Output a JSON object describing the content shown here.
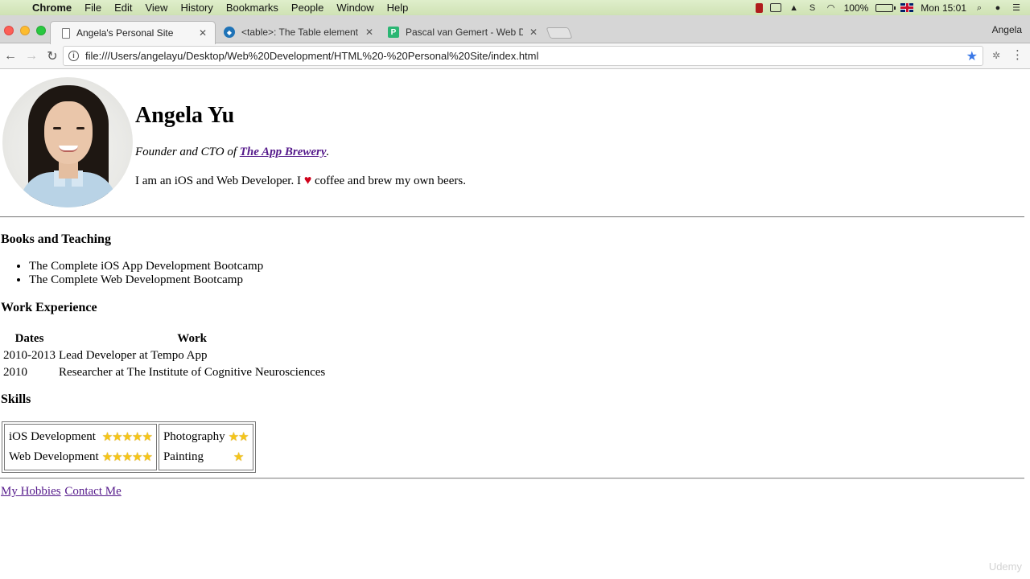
{
  "menubar": {
    "app": "Chrome",
    "items": [
      "File",
      "Edit",
      "View",
      "History",
      "Bookmarks",
      "People",
      "Window",
      "Help"
    ],
    "battery": "100%",
    "clock": "Mon 15:01"
  },
  "tabs": [
    {
      "title": "Angela's Personal Site",
      "icon": "document-icon",
      "active": true
    },
    {
      "title": "<table>: The Table element - H",
      "icon": "mdn-icon",
      "active": false
    },
    {
      "title": "Pascal van Gemert - Web Deve",
      "icon": "p-icon",
      "active": false
    }
  ],
  "profile_name": "Angela",
  "omnibox": {
    "url": "file:///Users/angelayu/Desktop/Web%20Development/HTML%20-%20Personal%20Site/index.html"
  },
  "page": {
    "name": "Angela Yu",
    "role_prefix": "Founder and CTO of ",
    "company": "The App Brewery",
    "role_suffix": ".",
    "bio_before": "I am an iOS and Web Developer. I ",
    "bio_heart": "♥",
    "bio_after": " coffee and brew my own beers.",
    "books_heading": "Books and Teaching",
    "books": [
      "The Complete iOS App Development Bootcamp",
      "The Complete Web Development Bootcamp"
    ],
    "work_heading": "Work Experience",
    "work_headers": [
      "Dates",
      "Work"
    ],
    "work_rows": [
      [
        "2010-2013",
        "Lead Developer at Tempo App"
      ],
      [
        "2010",
        "Researcher at The Institute of Cognitive Neurosciences"
      ]
    ],
    "skills_heading": "Skills",
    "skills_left": [
      {
        "label": "iOS Development",
        "stars": "★★★★★",
        "rating": 5
      },
      {
        "label": "Web Development",
        "stars": "★★★★★",
        "rating": 5
      }
    ],
    "skills_right": [
      {
        "label": "Photography",
        "stars": "★★",
        "rating": 2
      },
      {
        "label": "Painting",
        "stars": "★",
        "rating": 1
      }
    ],
    "links": [
      "My Hobbies",
      "Contact Me"
    ]
  },
  "watermark": "Udemy"
}
